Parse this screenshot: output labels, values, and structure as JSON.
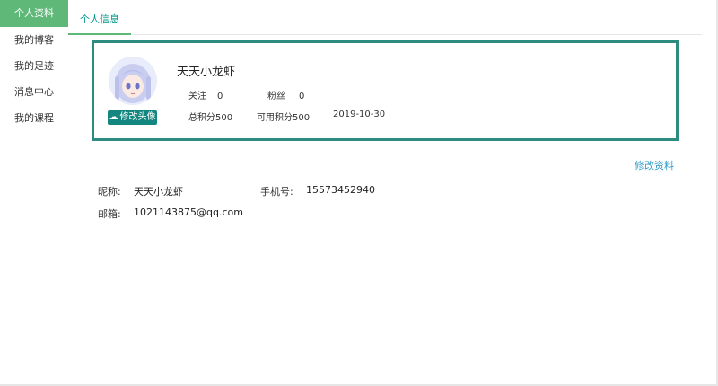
{
  "sidebar": {
    "items": [
      {
        "label": "个人资料"
      },
      {
        "label": "我的博客"
      },
      {
        "label": "我的足迹"
      },
      {
        "label": "消息中心"
      },
      {
        "label": "我的课程"
      }
    ]
  },
  "tabs": [
    {
      "label": "个人信息"
    }
  ],
  "profile": {
    "name": "天天小龙虾",
    "change_avatar_label": "修改头像",
    "follow_label": "关注",
    "follow_count": "0",
    "fans_label": "粉丝",
    "fans_count": "0",
    "total_points": "总积分500",
    "available_points": "可用积分500",
    "date": "2019-10-30"
  },
  "edit_profile_label": "修改资料",
  "details": {
    "nickname_label": "昵称:",
    "nickname_value": "天天小龙虾",
    "phone_label": "手机号:",
    "phone_value": "15573452940",
    "email_label": "邮箱:",
    "email_value": "1021143875@qq.com"
  },
  "colors": {
    "sidebar_active": "#5fb878",
    "card_border": "#2e8b80",
    "avatar_button": "#13877f",
    "link": "#2f9ac7"
  }
}
